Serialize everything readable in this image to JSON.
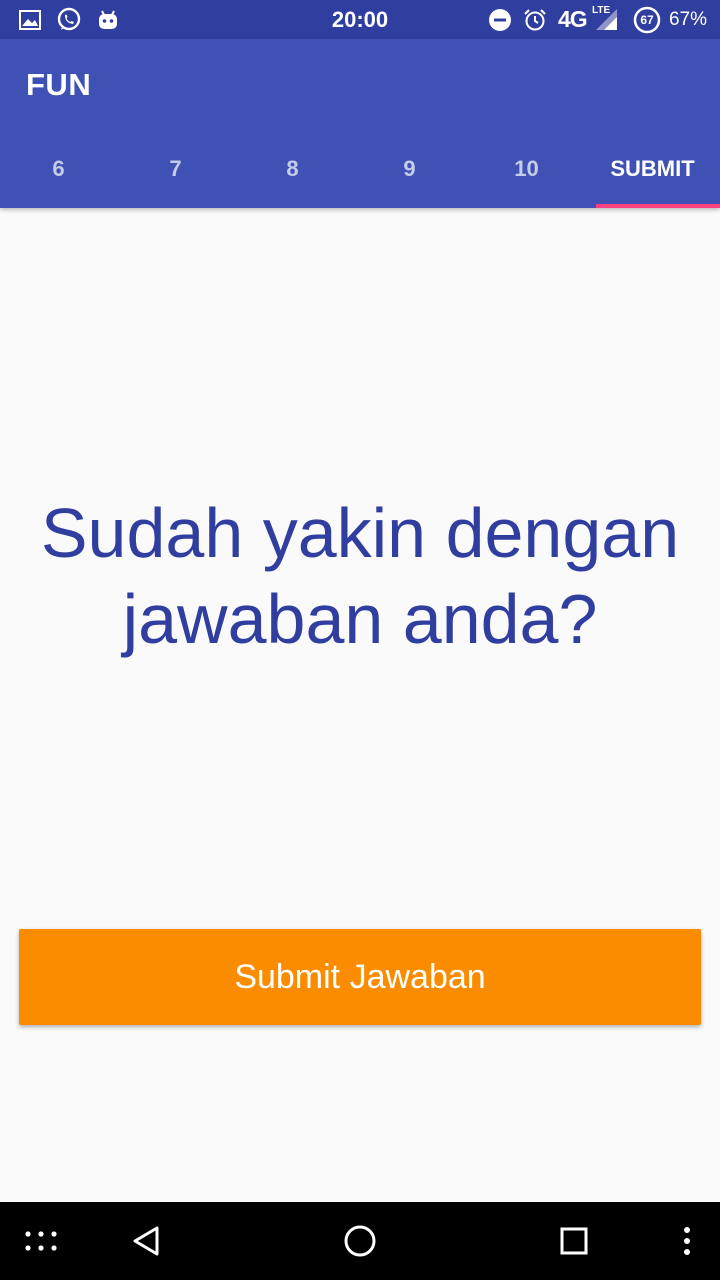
{
  "status_bar": {
    "time": "20:00",
    "network": "4G",
    "network_sub": "LTE",
    "battery_badge": "67",
    "battery_percent": "67%",
    "icons": [
      "gallery-icon",
      "whatsapp-icon",
      "android-icon",
      "do-not-disturb-icon",
      "alarm-icon",
      "signal-icon",
      "battery-icon"
    ]
  },
  "app_bar": {
    "title": "FUN",
    "tabs": [
      {
        "label": "6",
        "active": false
      },
      {
        "label": "7",
        "active": false
      },
      {
        "label": "8",
        "active": false
      },
      {
        "label": "9",
        "active": false
      },
      {
        "label": "10",
        "active": false
      },
      {
        "label": "SUBMIT",
        "active": true
      }
    ]
  },
  "content": {
    "question_line1": "Sudah yakin dengan",
    "question_line2": "jawaban anda?",
    "submit_label": "Submit Jawaban"
  },
  "colors": {
    "status_bar": "#303f9f",
    "app_bar": "#3f51b5",
    "tab_indicator": "#ff4081",
    "question_text": "#303f9f",
    "submit_button": "#fb8c00"
  },
  "nav_bar": {
    "icons": [
      "apps-dots-icon",
      "back-icon",
      "home-icon",
      "recents-icon",
      "more-vert-icon"
    ]
  }
}
